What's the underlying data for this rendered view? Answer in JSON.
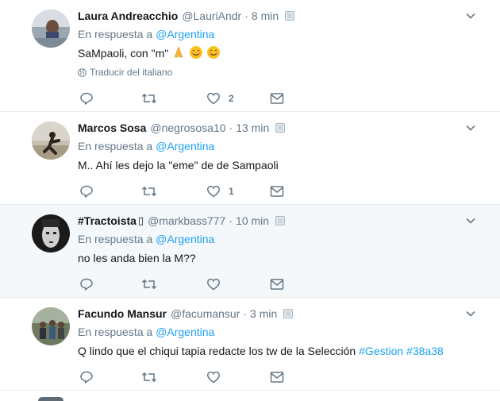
{
  "reply_prefix": "En respuesta a",
  "tweets": [
    {
      "name": "Laura Andreacchio",
      "handle": "@LauriAndr",
      "time": "8 min",
      "reply_to": "@Argentina",
      "text": "SaMpaoli, con \"m\"",
      "translate": "Traducir del italiano",
      "likes": "2"
    },
    {
      "name": "Marcos Sosa",
      "handle": "@negrososa10",
      "time": "13 min",
      "reply_to": "@Argentina",
      "text": "M.. Ahí les dejo la \"eme\" de de Sampaoli",
      "likes": "1"
    },
    {
      "name": "#Tractoista",
      "badge": "▯",
      "handle": "@markbass777",
      "time": "10 min",
      "reply_to": "@Argentina",
      "text": "no les anda bien la M??",
      "likes": ""
    },
    {
      "name": "Facundo Mansur",
      "handle": "@facumansur",
      "time": "3 min",
      "reply_to": "@Argentina",
      "text": "Q lindo que el chiqui tapia redacte los tw de la Selección",
      "hashtags": [
        "#Gestion",
        "#38a38"
      ],
      "likes": ""
    }
  ],
  "icons": {
    "reply": "reply-icon",
    "retweet": "retweet-icon",
    "like": "heart-icon",
    "dm": "envelope-icon",
    "menu": "chevron-down-icon",
    "translate": "globe-icon"
  },
  "colors": {
    "link": "#1da1f2",
    "secondary": "#657786",
    "hover_bg": "#f5f8fa",
    "border": "#e6ecf0"
  }
}
